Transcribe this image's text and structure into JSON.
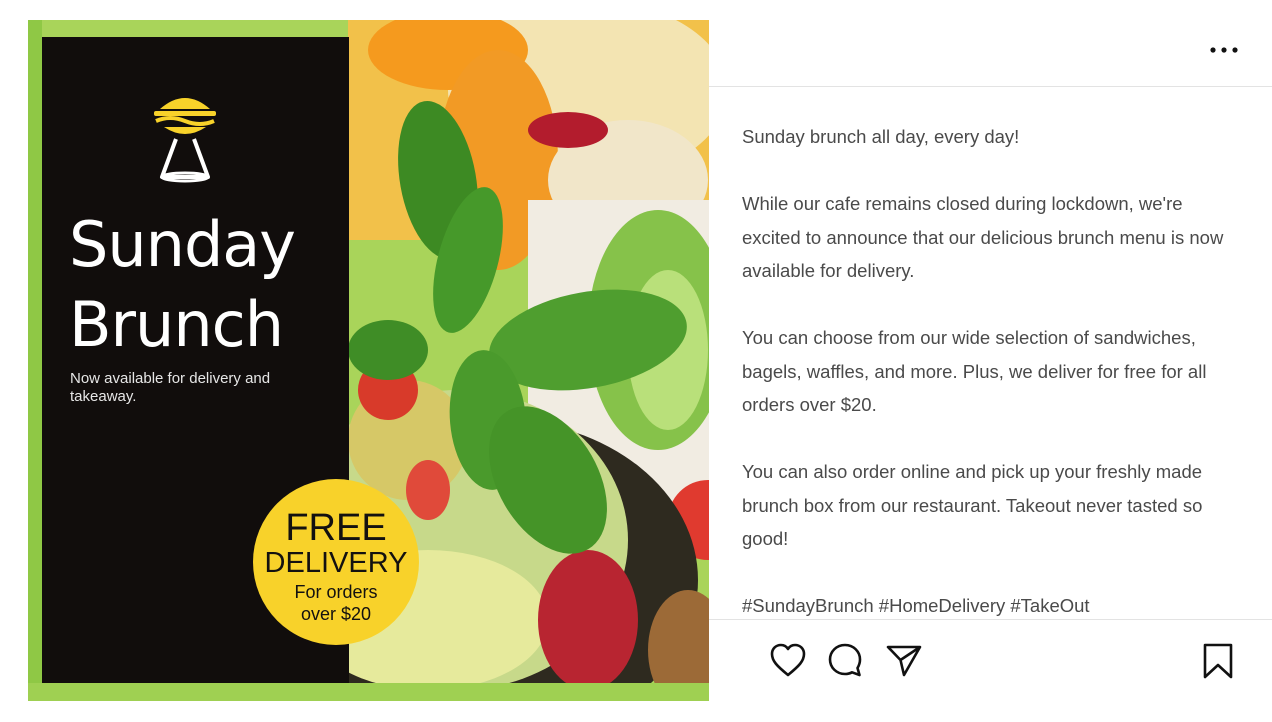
{
  "poster": {
    "title_line1": "Sunday",
    "title_line2": "Brunch",
    "subtitle": "Now available for delivery and takeaway.",
    "badge_free": "FREE",
    "badge_delivery": "DELIVERY",
    "badge_line1": "For orders",
    "badge_line2": "over $20",
    "logo_icon": "burger-lamp-icon",
    "accent_color": "#f8d22a",
    "panel_color": "#110d0c"
  },
  "header": {
    "menu_icon": "more-options-icon"
  },
  "caption": {
    "p1": "Sunday brunch all day, every day!",
    "p2": "While our cafe remains closed during lockdown, we're excited to announce that our delicious brunch menu is now available for delivery.",
    "p3": "You can choose from our wide selection of sandwiches, bagels, waffles, and more. Plus, we deliver for free for all orders over $20.",
    "p4": "You can also order online and pick up your freshly made brunch box from our restaurant. Takeout never tasted so good!",
    "hashtags": "#SundayBrunch #HomeDelivery #TakeOut"
  },
  "actions": {
    "like_icon": "heart-icon",
    "comment_icon": "comment-icon",
    "share_icon": "send-icon",
    "save_icon": "bookmark-icon"
  }
}
